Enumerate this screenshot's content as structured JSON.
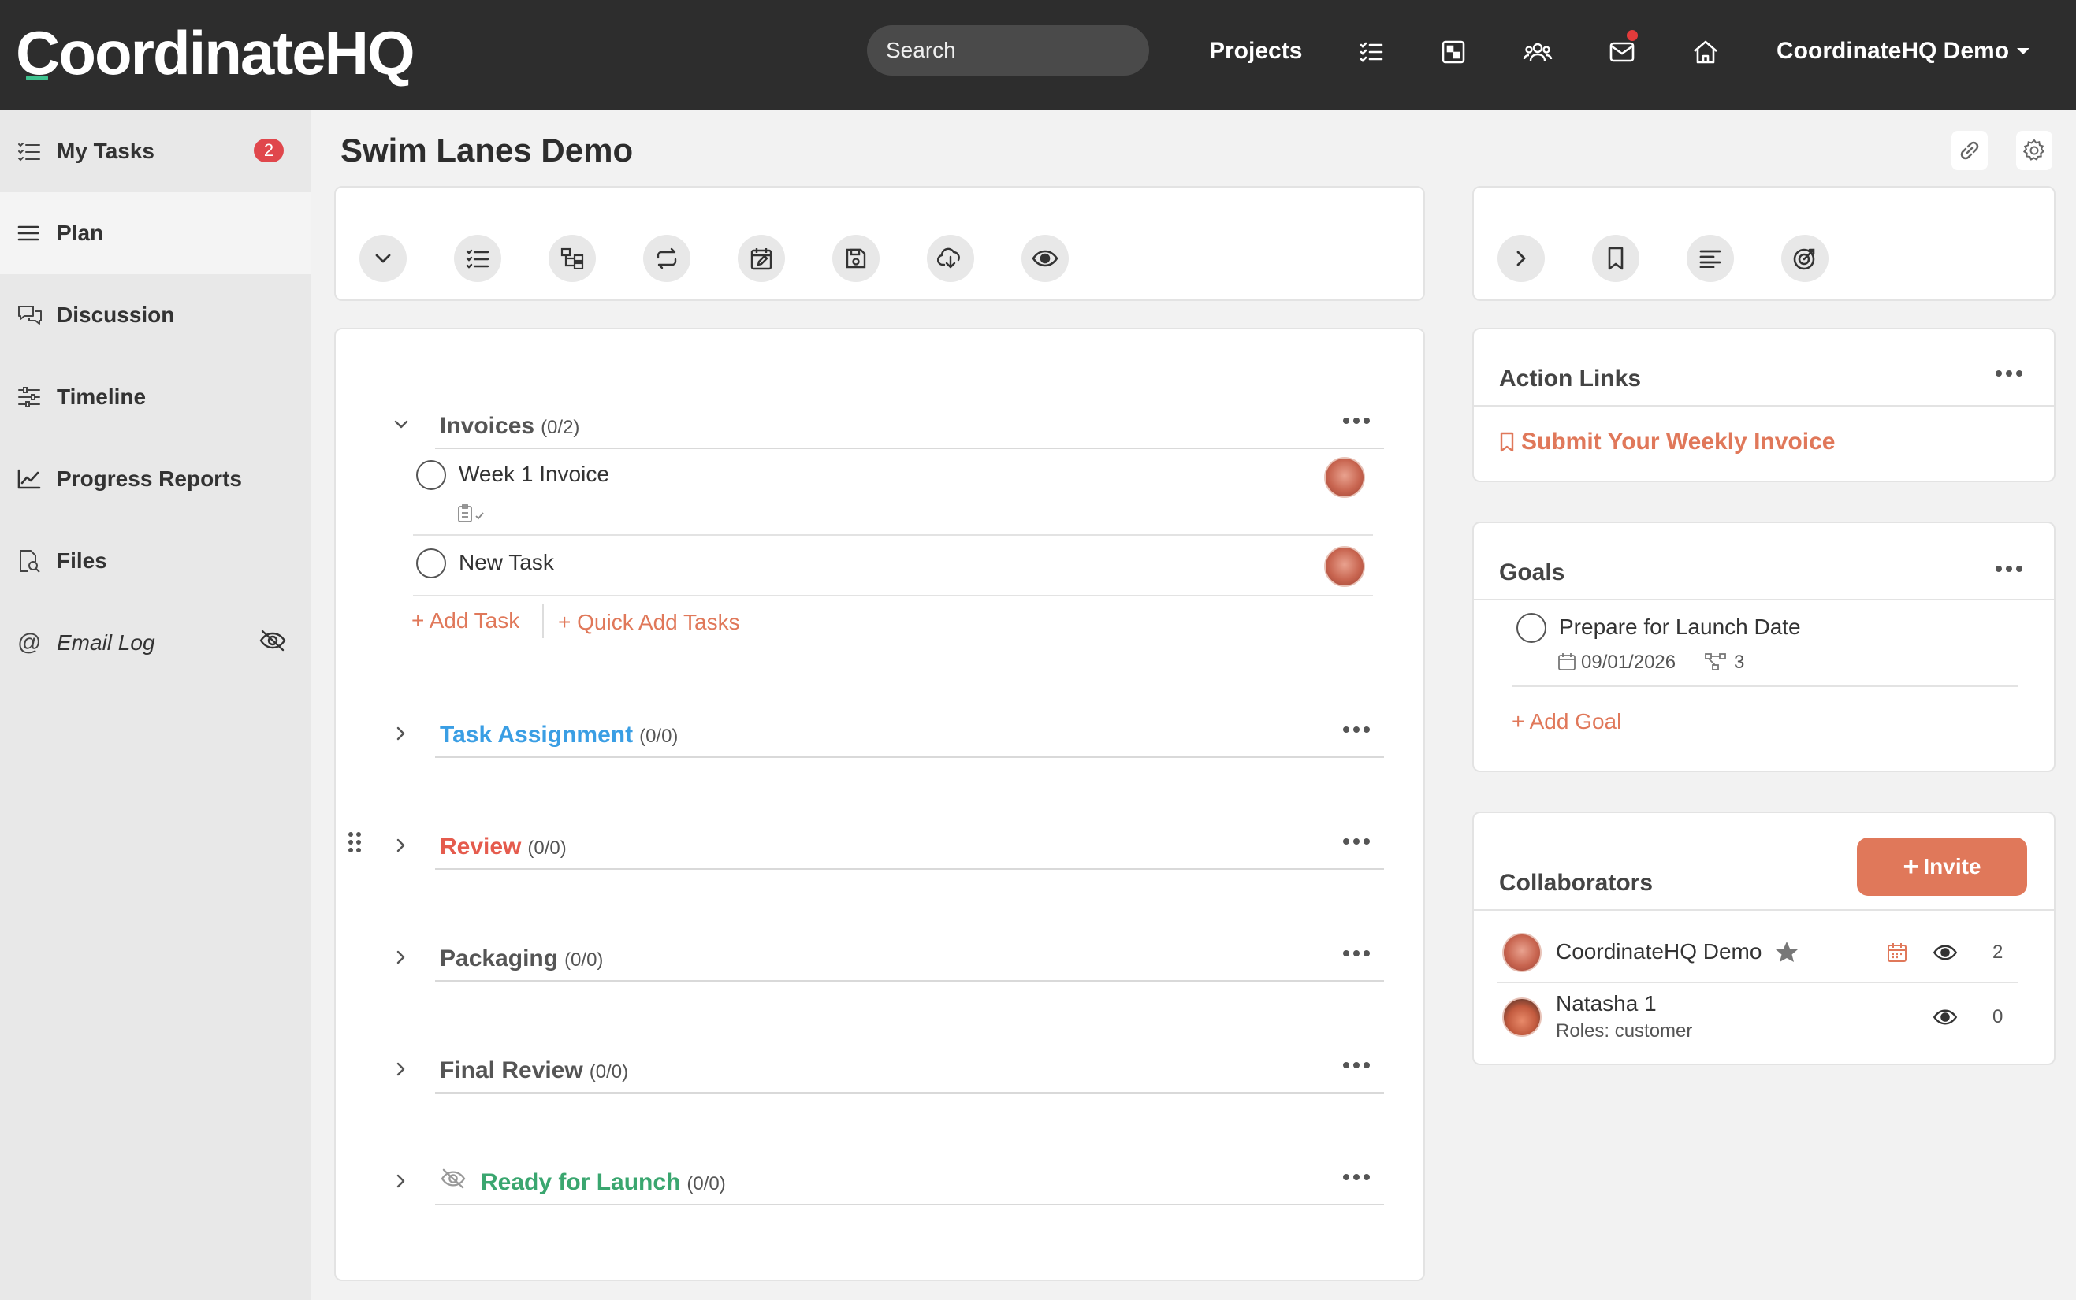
{
  "app": {
    "logo_text": "CoordinateHQ",
    "search_placeholder": "Search",
    "nav_projects": "Projects",
    "account_name": "CoordinateHQ Demo",
    "colors": {
      "topbar": "#2d2d2d",
      "accent": "#e0785a",
      "badge": "#e0474c",
      "brand_green": "#3ec28f"
    }
  },
  "sidebar": {
    "items": [
      {
        "label": "My Tasks",
        "icon": "checklist-icon",
        "badge": "2"
      },
      {
        "label": "Plan",
        "icon": "menu-lines-icon",
        "active": true
      },
      {
        "label": "Discussion",
        "icon": "chat-bubbles-icon"
      },
      {
        "label": "Timeline",
        "icon": "sliders-icon"
      },
      {
        "label": "Progress Reports",
        "icon": "line-chart-icon"
      },
      {
        "label": "Files",
        "icon": "file-search-icon"
      },
      {
        "label": "Email Log",
        "icon": "at-sign-icon",
        "hidden_indicator": "eye-slash-icon"
      }
    ]
  },
  "page": {
    "title": "Swim Lanes Demo"
  },
  "groups": [
    {
      "name": "Invoices",
      "count": "(0/2)",
      "color": "#555555",
      "expanded": true
    },
    {
      "name": "Task Assignment",
      "count": "(0/0)",
      "color": "#3a9ee4"
    },
    {
      "name": "Review",
      "count": "(0/0)",
      "color": "#e55b4d"
    },
    {
      "name": "Packaging",
      "count": "(0/0)",
      "color": "#555555"
    },
    {
      "name": "Final Review",
      "count": "(0/0)",
      "color": "#555555"
    },
    {
      "name": "Ready for Launch",
      "count": "(0/0)",
      "color": "#3aa66f",
      "hidden": true
    }
  ],
  "tasks": [
    {
      "name": "Week 1 Invoice"
    },
    {
      "name": "New Task"
    }
  ],
  "task_actions": {
    "add_task": "+ Add Task",
    "quick_add": "+ Quick Add Tasks"
  },
  "action_links": {
    "title": "Action Links",
    "link": "Submit Your Weekly Invoice"
  },
  "goals": {
    "title": "Goals",
    "items": [
      {
        "name": "Prepare for Launch Date",
        "date": "09/01/2026",
        "linked": "3"
      }
    ],
    "add_goal": "+ Add Goal"
  },
  "collaborators": {
    "title": "Collaborators",
    "invite": "Invite",
    "people": [
      {
        "name": "CoordinateHQ Demo",
        "views": "2",
        "owner": true
      },
      {
        "name": "Natasha 1",
        "roles": "Roles: customer",
        "views": "0"
      }
    ]
  }
}
